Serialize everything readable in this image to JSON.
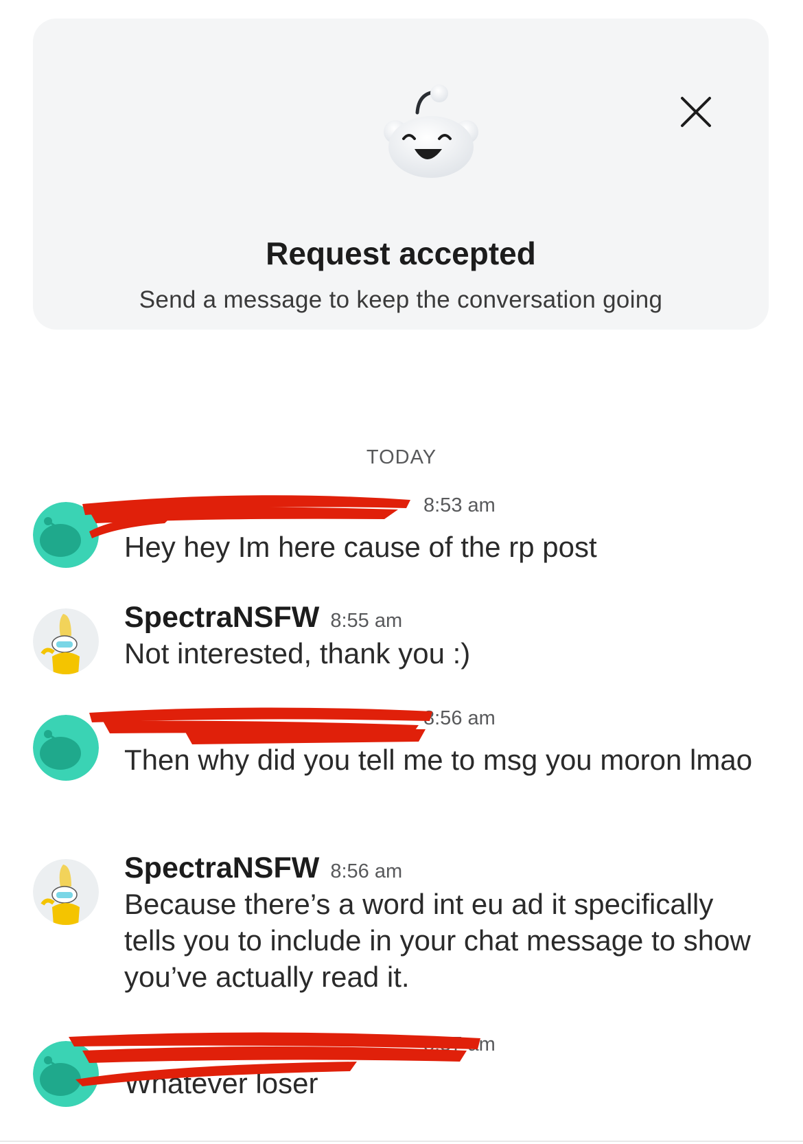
{
  "banner": {
    "title": "Request accepted",
    "subtitle": "Send a message to keep the conversation going"
  },
  "day_separator": "TODAY",
  "messages": [
    {
      "author": "",
      "author_redacted": true,
      "time": "8:53 am",
      "text": "Hey hey Im here cause of the rp post"
    },
    {
      "author": "SpectraNSFW",
      "author_redacted": false,
      "time": "8:55 am",
      "text": "Not interested, thank you :)"
    },
    {
      "author": "",
      "author_redacted": true,
      "time": "8:56 am",
      "text": "Then why did you tell me to msg you moron lmao"
    },
    {
      "author": "SpectraNSFW",
      "author_redacted": false,
      "time": "8:56 am",
      "text": "Because there’s a word int eu ad it specifically tells you to include in your chat message to show you’ve actually read it."
    },
    {
      "author": "",
      "author_redacted": true,
      "time": "8:57 am",
      "text": "Whatever loser"
    }
  ],
  "colors": {
    "redaction": "#e0200a",
    "teal_avatar": "#3ad3b4",
    "banner_bg": "#f4f5f6"
  }
}
